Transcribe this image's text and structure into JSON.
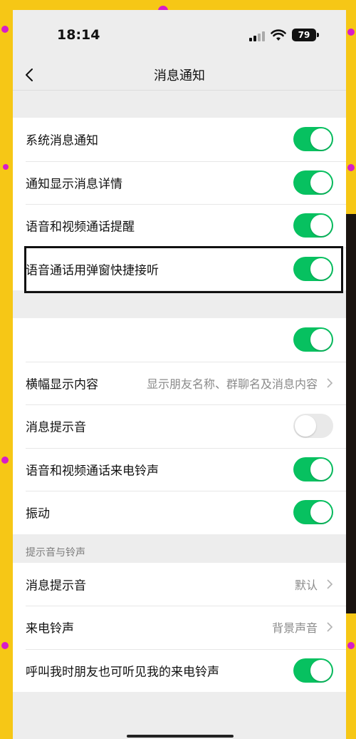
{
  "status_bar": {
    "time": "18:14",
    "battery": "79"
  },
  "nav": {
    "title": "消息通知"
  },
  "group1": [
    {
      "label": "系统消息通知",
      "on": true
    },
    {
      "label": "通知显示消息详情",
      "on": true
    },
    {
      "label": "语音和视频通话提醒",
      "on": true
    },
    {
      "label": "语音通话用弹窗快捷接听",
      "on": true
    }
  ],
  "group2": [
    {
      "label": "",
      "type": "toggle",
      "on": true
    },
    {
      "label": "横幅显示内容",
      "type": "link",
      "value": "显示朋友名称、群聊名及消息内容"
    },
    {
      "label": "消息提示音",
      "type": "toggle",
      "on": false
    },
    {
      "label": "语音和视频通话来电铃声",
      "type": "toggle",
      "on": true
    },
    {
      "label": "振动",
      "type": "toggle",
      "on": true
    }
  ],
  "section3": {
    "header": "提示音与铃声"
  },
  "group3": [
    {
      "label": "消息提示音",
      "type": "link",
      "value": "默认"
    },
    {
      "label": "来电铃声",
      "type": "link",
      "value": "背景声音"
    },
    {
      "label": "呼叫我时朋友也可听见我的来电铃声",
      "type": "toggle",
      "on": true
    }
  ],
  "colors": {
    "accent": "#07c160",
    "background": "#ededed",
    "frame": "#f6c716"
  }
}
